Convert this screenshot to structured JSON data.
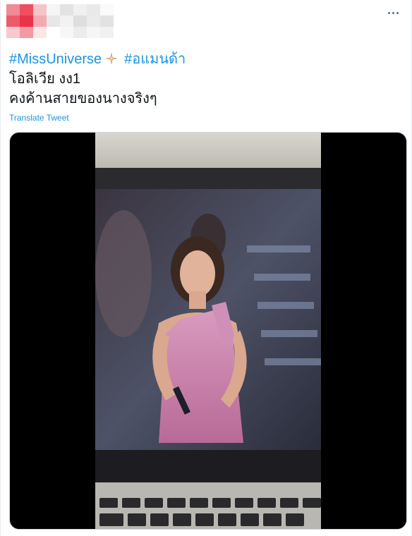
{
  "tweet": {
    "hashtags": [
      "#MissUniverse",
      "#อแมนด้า"
    ],
    "line2": "โอลิเวีย งง1",
    "line3": "คงค้านสายของนางจริงๆ",
    "translate_label": "Translate Tweet",
    "icons": {
      "more": "more-horizontal-icon",
      "sparkle": "sparkle-emoji-icon"
    }
  },
  "media": {
    "type": "video",
    "description_visible": false
  },
  "colors": {
    "link": "#1b95e0",
    "text": "#0f1419",
    "media_bg": "#000000",
    "border": "#cfd9de"
  }
}
